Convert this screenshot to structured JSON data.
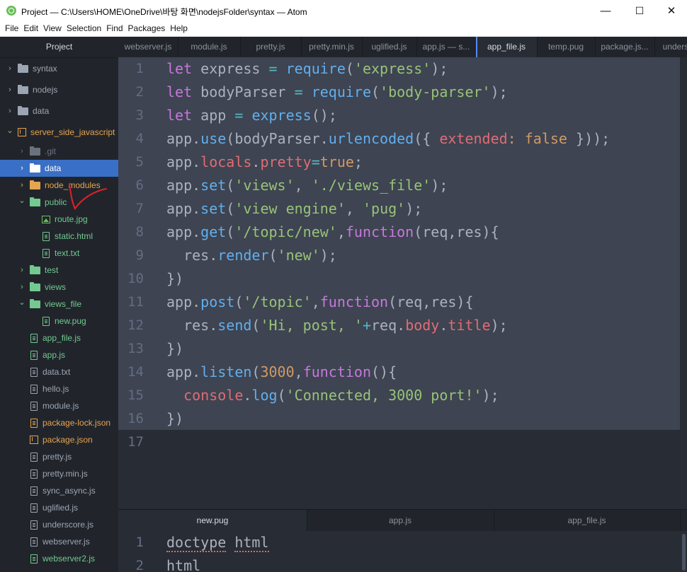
{
  "window": {
    "title": "Project — C:\\Users\\HOME\\OneDrive\\바탕 화면\\nodejsFolder\\syntax — Atom",
    "minimize": "—",
    "maximize": "☐",
    "close": "✕"
  },
  "menu": [
    "File",
    "Edit",
    "View",
    "Selection",
    "Find",
    "Packages",
    "Help"
  ],
  "sidebar": {
    "header": "Project",
    "items": [
      {
        "label": "syntax",
        "type": "folder",
        "level": 0,
        "expanded": false,
        "color": "#9da5b4"
      },
      {
        "label": "nodejs",
        "type": "folder",
        "level": 0,
        "expanded": false,
        "color": "#9da5b4"
      },
      {
        "label": "data",
        "type": "folder",
        "level": 0,
        "expanded": false,
        "color": "#9da5b4"
      },
      {
        "label": "server_side_javascript",
        "type": "repo",
        "level": 0,
        "expanded": true,
        "color": "#e5a44f"
      },
      {
        "label": ".git",
        "type": "folder",
        "level": 1,
        "expanded": false,
        "color": "#6b717d"
      },
      {
        "label": "data",
        "type": "folder",
        "level": 1,
        "expanded": false,
        "color": "#ffffff",
        "selected": true
      },
      {
        "label": "node_modules",
        "type": "folder",
        "level": 1,
        "expanded": false,
        "color": "#e5a44f"
      },
      {
        "label": "public",
        "type": "folder",
        "level": 1,
        "expanded": true,
        "color": "#73c990"
      },
      {
        "label": "route.jpg",
        "type": "image",
        "level": 2,
        "color": "#73c990"
      },
      {
        "label": "static.html",
        "type": "file",
        "level": 2,
        "color": "#73c990"
      },
      {
        "label": "text.txt",
        "type": "file",
        "level": 2,
        "color": "#73c990"
      },
      {
        "label": "test",
        "type": "folder",
        "level": 1,
        "expanded": false,
        "color": "#73c990"
      },
      {
        "label": "views",
        "type": "folder",
        "level": 1,
        "expanded": false,
        "color": "#73c990"
      },
      {
        "label": "views_file",
        "type": "folder",
        "level": 1,
        "expanded": true,
        "color": "#73c990"
      },
      {
        "label": "new.pug",
        "type": "file",
        "level": 2,
        "color": "#73c990"
      },
      {
        "label": "app_file.js",
        "type": "file",
        "level": 1,
        "color": "#73c990"
      },
      {
        "label": "app.js",
        "type": "file",
        "level": 1,
        "color": "#73c990"
      },
      {
        "label": "data.txt",
        "type": "file",
        "level": 1,
        "color": "#9da5b4"
      },
      {
        "label": "hello.js",
        "type": "file",
        "level": 1,
        "color": "#9da5b4"
      },
      {
        "label": "module.js",
        "type": "file",
        "level": 1,
        "color": "#9da5b4"
      },
      {
        "label": "package-lock.json",
        "type": "file",
        "level": 1,
        "color": "#e5a44f"
      },
      {
        "label": "package.json",
        "type": "package",
        "level": 1,
        "color": "#e5a44f"
      },
      {
        "label": "pretty.js",
        "type": "file",
        "level": 1,
        "color": "#9da5b4"
      },
      {
        "label": "pretty.min.js",
        "type": "file",
        "level": 1,
        "color": "#9da5b4"
      },
      {
        "label": "sync_async.js",
        "type": "file",
        "level": 1,
        "color": "#9da5b4"
      },
      {
        "label": "uglified.js",
        "type": "file",
        "level": 1,
        "color": "#9da5b4"
      },
      {
        "label": "underscore.js",
        "type": "file",
        "level": 1,
        "color": "#9da5b4"
      },
      {
        "label": "webserver.js",
        "type": "file",
        "level": 1,
        "color": "#9da5b4"
      },
      {
        "label": "webserver2.js",
        "type": "file",
        "level": 1,
        "color": "#73c990"
      }
    ]
  },
  "tabs": [
    {
      "label": "webserver.js",
      "active": false
    },
    {
      "label": "module.js",
      "active": false
    },
    {
      "label": "pretty.js",
      "active": false
    },
    {
      "label": "pretty.min.js",
      "active": false
    },
    {
      "label": "uglified.js",
      "active": false
    },
    {
      "label": "app.js — s...",
      "active": false
    },
    {
      "label": "app_file.js",
      "active": true
    },
    {
      "label": "temp.pug",
      "active": false
    },
    {
      "label": "package.js...",
      "active": false
    },
    {
      "label": "unders",
      "active": false
    }
  ],
  "editor": {
    "line_numbers": [
      "1",
      "2",
      "3",
      "4",
      "5",
      "6",
      "7",
      "8",
      "9",
      "10",
      "11",
      "12",
      "13",
      "14",
      "15",
      "16",
      "17"
    ],
    "lines": [
      [
        [
          "k",
          "let"
        ],
        [
          "t",
          " express "
        ],
        [
          "o",
          "="
        ],
        [
          "t",
          " "
        ],
        [
          "f",
          "require"
        ],
        [
          "t",
          "("
        ],
        [
          "s",
          "'express'"
        ],
        [
          "t",
          ");"
        ]
      ],
      [
        [
          "k",
          "let"
        ],
        [
          "t",
          " bodyParser "
        ],
        [
          "o",
          "="
        ],
        [
          "t",
          " "
        ],
        [
          "f",
          "require"
        ],
        [
          "t",
          "("
        ],
        [
          "s",
          "'body-parser'"
        ],
        [
          "t",
          ");"
        ]
      ],
      [
        [
          "k",
          "let"
        ],
        [
          "t",
          " app "
        ],
        [
          "o",
          "="
        ],
        [
          "t",
          " "
        ],
        [
          "f",
          "express"
        ],
        [
          "t",
          "();"
        ]
      ],
      [
        [
          "t",
          "app."
        ],
        [
          "f",
          "use"
        ],
        [
          "t",
          "(bodyParser."
        ],
        [
          "f",
          "urlencoded"
        ],
        [
          "t",
          "({ "
        ],
        [
          "p",
          "extended"
        ],
        [
          "n",
          ":"
        ],
        [
          "t",
          " "
        ],
        [
          "n",
          "false"
        ],
        [
          "t",
          " }));"
        ]
      ],
      [
        [
          "t",
          "app."
        ],
        [
          "p",
          "locals"
        ],
        [
          "t",
          "."
        ],
        [
          "p",
          "pretty"
        ],
        [
          "o",
          "="
        ],
        [
          "n",
          "true"
        ],
        [
          "t",
          ";"
        ]
      ],
      [
        [
          "t",
          "app."
        ],
        [
          "f",
          "set"
        ],
        [
          "t",
          "("
        ],
        [
          "s",
          "'views'"
        ],
        [
          "t",
          ", "
        ],
        [
          "s",
          "'./views_file'"
        ],
        [
          "t",
          ");"
        ]
      ],
      [
        [
          "t",
          "app."
        ],
        [
          "f",
          "set"
        ],
        [
          "t",
          "("
        ],
        [
          "s",
          "'view engine'"
        ],
        [
          "t",
          ", "
        ],
        [
          "s",
          "'pug'"
        ],
        [
          "t",
          ");"
        ]
      ],
      [
        [
          "t",
          "app."
        ],
        [
          "f",
          "get"
        ],
        [
          "t",
          "("
        ],
        [
          "s",
          "'/topic/new'"
        ],
        [
          "t",
          ","
        ],
        [
          "k",
          "function"
        ],
        [
          "t",
          "(req,res){"
        ]
      ],
      [
        [
          "t",
          "  res."
        ],
        [
          "f",
          "render"
        ],
        [
          "t",
          "("
        ],
        [
          "s",
          "'new'"
        ],
        [
          "t",
          ");"
        ]
      ],
      [
        [
          "t",
          "})"
        ]
      ],
      [
        [
          "t",
          "app."
        ],
        [
          "f",
          "post"
        ],
        [
          "t",
          "("
        ],
        [
          "s",
          "'/topic'"
        ],
        [
          "t",
          ","
        ],
        [
          "k",
          "function"
        ],
        [
          "t",
          "(req,res){"
        ]
      ],
      [
        [
          "t",
          "  res."
        ],
        [
          "f",
          "send"
        ],
        [
          "t",
          "("
        ],
        [
          "s",
          "'Hi, post, '"
        ],
        [
          "o",
          "+"
        ],
        [
          "t",
          "req."
        ],
        [
          "p",
          "body"
        ],
        [
          "t",
          "."
        ],
        [
          "p",
          "title"
        ],
        [
          "t",
          ");"
        ]
      ],
      [
        [
          "t",
          "})"
        ]
      ],
      [
        [
          "t",
          "app."
        ],
        [
          "f",
          "listen"
        ],
        [
          "t",
          "("
        ],
        [
          "n",
          "3000"
        ],
        [
          "t",
          ","
        ],
        [
          "k",
          "function"
        ],
        [
          "t",
          "(){"
        ]
      ],
      [
        [
          "t",
          "  "
        ],
        [
          "p",
          "console"
        ],
        [
          "t",
          "."
        ],
        [
          "f",
          "log"
        ],
        [
          "t",
          "("
        ],
        [
          "s",
          "'Connected, 3000 port!'"
        ],
        [
          "t",
          ");"
        ]
      ],
      [
        [
          "t",
          "})"
        ]
      ],
      [
        [
          "t",
          ""
        ]
      ]
    ]
  },
  "bottom_tabs": [
    {
      "label": "new.pug",
      "active": true
    },
    {
      "label": "app.js",
      "active": false
    },
    {
      "label": "app_file.js",
      "active": false
    }
  ],
  "bottom_editor": {
    "line_numbers": [
      "1",
      "2"
    ],
    "lines": [
      [
        "doctype",
        "html"
      ],
      [
        "html"
      ]
    ]
  }
}
